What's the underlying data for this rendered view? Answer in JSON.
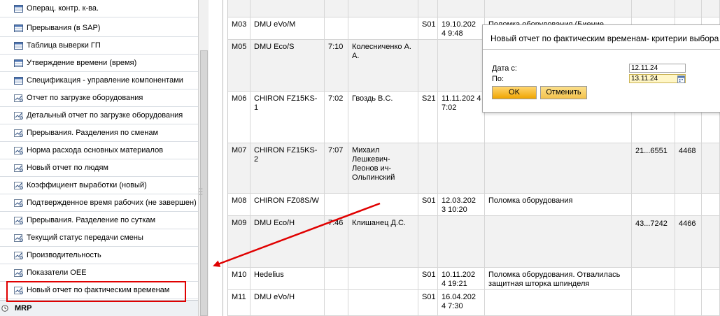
{
  "sidebar": {
    "items": [
      {
        "label": "Операц. контр. к-ва.",
        "icon": "table-icon"
      },
      {
        "label": "Прерывания (в SAP)",
        "icon": "table-icon"
      },
      {
        "label": "Таблица выверки ГП",
        "icon": "table-icon"
      },
      {
        "label": "Утверждение времени (время)",
        "icon": "table-icon"
      },
      {
        "label": "Спецификация - управление компонентами",
        "icon": "table-icon"
      },
      {
        "label": "Отчет по загрузке оборудования",
        "icon": "report-icon"
      },
      {
        "label": "Детальный отчет по загрузке оборудования",
        "icon": "report-icon"
      },
      {
        "label": "Прерывания. Разделения по сменам",
        "icon": "report-icon"
      },
      {
        "label": "Норма расхода основных материалов",
        "icon": "report-icon"
      },
      {
        "label": "Новый отчет по людям",
        "icon": "report-icon"
      },
      {
        "label": "Коэффициент выработки (новый)",
        "icon": "report-icon"
      },
      {
        "label": "Подтвержденное время рабочих (не завершен)",
        "icon": "report-icon"
      },
      {
        "label": "Прерывания. Разделение по суткам",
        "icon": "report-icon"
      },
      {
        "label": "Текущий статус передачи смены",
        "icon": "report-icon"
      },
      {
        "label": "Производительность",
        "icon": "report-icon"
      },
      {
        "label": "Показатели OEE",
        "icon": "report-icon"
      },
      {
        "label": "Новый отчет по фактическим временам",
        "icon": "report-icon"
      }
    ],
    "footer": {
      "label": "MRP",
      "icon": "clock-icon"
    }
  },
  "table": {
    "rows": [
      {
        "station": "",
        "machine": "",
        "time": "",
        "person": "",
        "code": "",
        "date": "",
        "reason": "",
        "order": "",
        "qty": "",
        "tone": "grey"
      },
      {
        "station": "M03",
        "machine": "DMU eVo/M",
        "time": "",
        "person": "",
        "code": "S01",
        "date": "19.10.202 4 9:48",
        "reason": "Поломка оборудования (Биение",
        "order": "",
        "qty": "",
        "tone": "white"
      },
      {
        "station": "M05",
        "machine": "DMU Eco/S",
        "time": "7:10",
        "person": "Колесниченко А. А.",
        "code": "",
        "date": "",
        "reason": "",
        "order": "",
        "qty": "",
        "tone": "grey"
      },
      {
        "station": "M06",
        "machine": "CHIRON FZ15KS-1",
        "time": "7:02",
        "person": "Гвоздь В.С.",
        "code": "S21",
        "date": "11.11.202 4 7:02",
        "reason": "",
        "order": "",
        "qty": "",
        "tone": "white"
      },
      {
        "station": "M07",
        "machine": "CHIRON FZ15KS-2",
        "time": "7:07",
        "person": "Михаил Лешкевич-Леонов ич-Ольпинский",
        "code": "",
        "date": "",
        "reason": "",
        "order": "21...6551",
        "qty": "4468",
        "tone": "grey"
      },
      {
        "station": "M08",
        "machine": "CHIRON FZ08S/W",
        "time": "",
        "person": "",
        "code": "S01",
        "date": "12.03.202 3 10:20",
        "reason": "Поломка оборудования",
        "order": "",
        "qty": "",
        "tone": "white"
      },
      {
        "station": "M09",
        "machine": "DMU Eco/H",
        "time": "7:46",
        "person": "Клишанец Д.С.",
        "code": "",
        "date": "",
        "reason": "",
        "order": "43...7242",
        "qty": "4466",
        "tone": "grey"
      },
      {
        "station": "M10",
        "machine": "Hedelius",
        "time": "",
        "person": "",
        "code": "S01",
        "date": "10.11.202 4 19:21",
        "reason": "Поломка оборудования. Отвалилась защитная шторка шпинделя",
        "order": "",
        "qty": "",
        "tone": "white"
      },
      {
        "station": "M11",
        "machine": "DMU eVo/H",
        "time": "",
        "person": "",
        "code": "S01",
        "date": "16.04.202 4 7:30",
        "reason": "",
        "order": "",
        "qty": "",
        "tone": "white"
      }
    ]
  },
  "dialog": {
    "title": "Новый отчет по фактическим временам- критерии выбора",
    "date_from_label": "Дата с:",
    "date_to_label": "По:",
    "date_from_value": "12.11.24",
    "date_to_value": "13.11.24",
    "ok_label": "OK",
    "cancel_label": "Отменить",
    "calendar_icon": "calendar-icon"
  },
  "colors": {
    "annotation": "#e00000",
    "ok_button": "#f0a500",
    "field_highlight": "#fff6c6"
  }
}
